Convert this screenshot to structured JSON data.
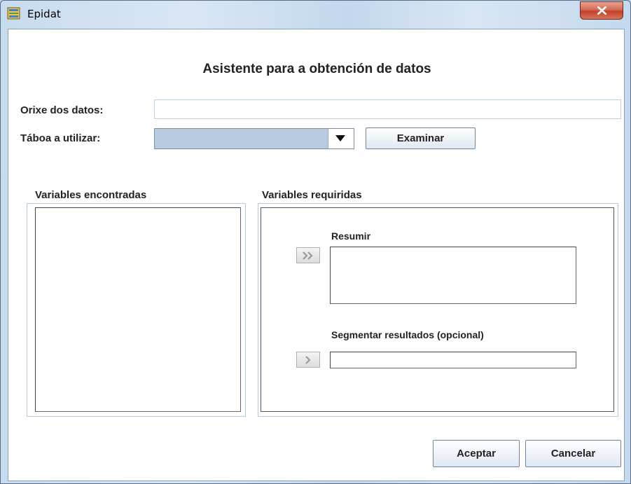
{
  "window": {
    "title": "Epidat",
    "icon": "epidat-app-icon",
    "close_icon": "close-icon"
  },
  "dialog": {
    "heading": "Asistente para a obtención de datos",
    "source_label": "Orixe dos datos:",
    "source_value": "",
    "table_label": "Táboa a utilizar:",
    "table_selected": "",
    "browse_button": "Examinar",
    "found_group_title": "Variables encontradas",
    "required_group_title": "Variables requiridas",
    "summarize_label": "Resumir",
    "segment_label": "Segmentar resultados (opcional)",
    "add_many_icon": "double-chevron-right-icon",
    "add_one_icon": "chevron-right-icon",
    "accept_button": "Aceptar",
    "cancel_button": "Cancelar"
  },
  "colors": {
    "close_button": "#c9452f",
    "combo_fill": "#b8cbe0",
    "group_border": "#b6cadd"
  }
}
